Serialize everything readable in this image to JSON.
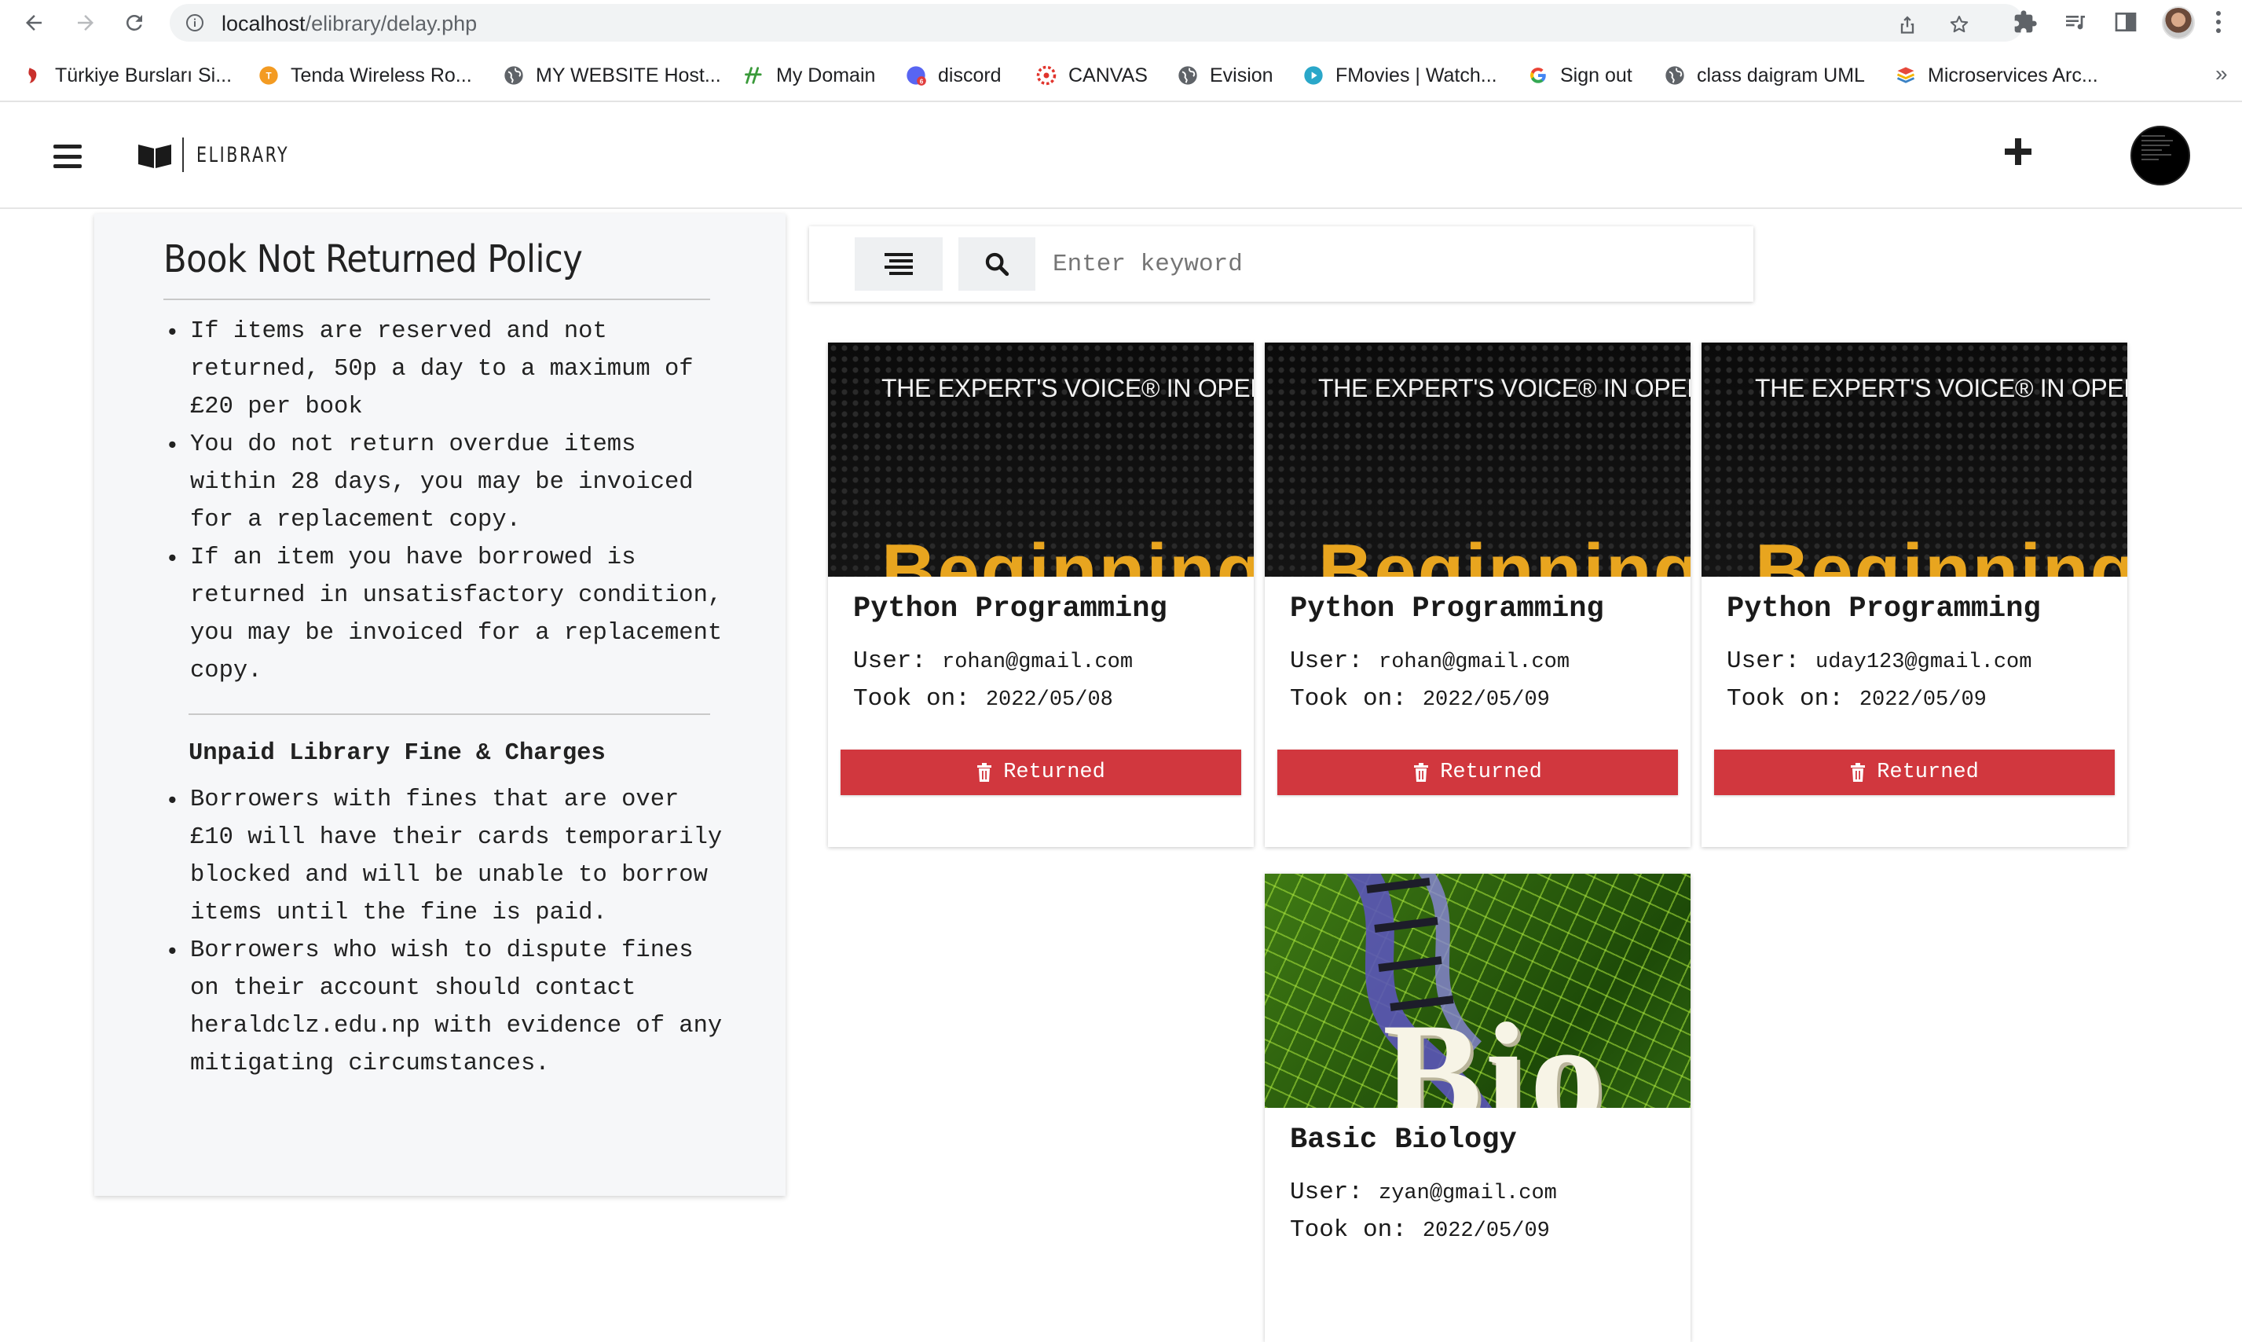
{
  "browser": {
    "url_host": "localhost",
    "url_path": "/elibrary/delay.php",
    "bookmarks": [
      {
        "label": "Türkiye Bursları Si...",
        "icon": "turkiye-burslari-icon"
      },
      {
        "label": "Tenda Wireless Ro...",
        "icon": "tenda-icon"
      },
      {
        "label": "MY WEBSITE Host...",
        "icon": "globe-icon"
      },
      {
        "label": "My Domain",
        "icon": "hostinger-icon"
      },
      {
        "label": "discord",
        "icon": "discord-icon"
      },
      {
        "label": "CANVAS",
        "icon": "canvas-icon"
      },
      {
        "label": "Evision",
        "icon": "globe-icon"
      },
      {
        "label": "FMovies | Watch...",
        "icon": "play-icon"
      },
      {
        "label": "Sign out",
        "icon": "google-icon"
      },
      {
        "label": "class daigram UML",
        "icon": "globe-icon"
      },
      {
        "label": "Microservices Arc...",
        "icon": "stack-icon"
      }
    ],
    "more_bookmarks": "»"
  },
  "header": {
    "logo_text": "ELIBRARY"
  },
  "policy": {
    "title": "Book Not Returned Policy",
    "items": [
      "If items are reserved and not returned, 50p a day to a maximum of £20 per book",
      "You do not return overdue items within 28 days, you may be invoiced for a replacement copy.",
      "If an item you have borrowed is returned in unsatisfactory condition, you may be invoiced for a replacement copy."
    ],
    "fines_heading": "Unpaid Library Fine & Charges",
    "fines_items": [
      "Borrowers with fines that are over £10 will have their cards temporarily blocked and will be unable to borrow items until the fine is paid.",
      "Borrowers who wish to dispute fines on their account should contact heraldclz.edu.np with evidence of any mitigating circumstances."
    ]
  },
  "search": {
    "placeholder": "Enter keyword"
  },
  "labels": {
    "user": "User:",
    "took_on": "Took on:",
    "returned_button": "Returned"
  },
  "books": [
    {
      "title": "Python Programming",
      "user": "rohan@gmail.com",
      "took_on": "2022/05/08",
      "cover_line": "THE EXPERT'S VOICE® IN OPEN SOURCE",
      "cover_big": "Beginning"
    },
    {
      "title": "Python Programming",
      "user": "rohan@gmail.com",
      "took_on": "2022/05/09",
      "cover_line": "THE EXPERT'S VOICE® IN OPEN SOURCE",
      "cover_big": "Beginning"
    },
    {
      "title": "Python Programming",
      "user": "uday123@gmail.com",
      "took_on": "2022/05/09",
      "cover_line": "THE EXPERT'S VOICE® IN OPEN SOURCE",
      "cover_big": "Beginning"
    },
    {
      "title": "Basic Biology",
      "user": "zyan@gmail.com",
      "took_on": "2022/05/09",
      "cover_big": "Bio"
    }
  ],
  "colors": {
    "returned_button": "#d1373e",
    "policy_panel_bg": "#f6f7f9"
  }
}
